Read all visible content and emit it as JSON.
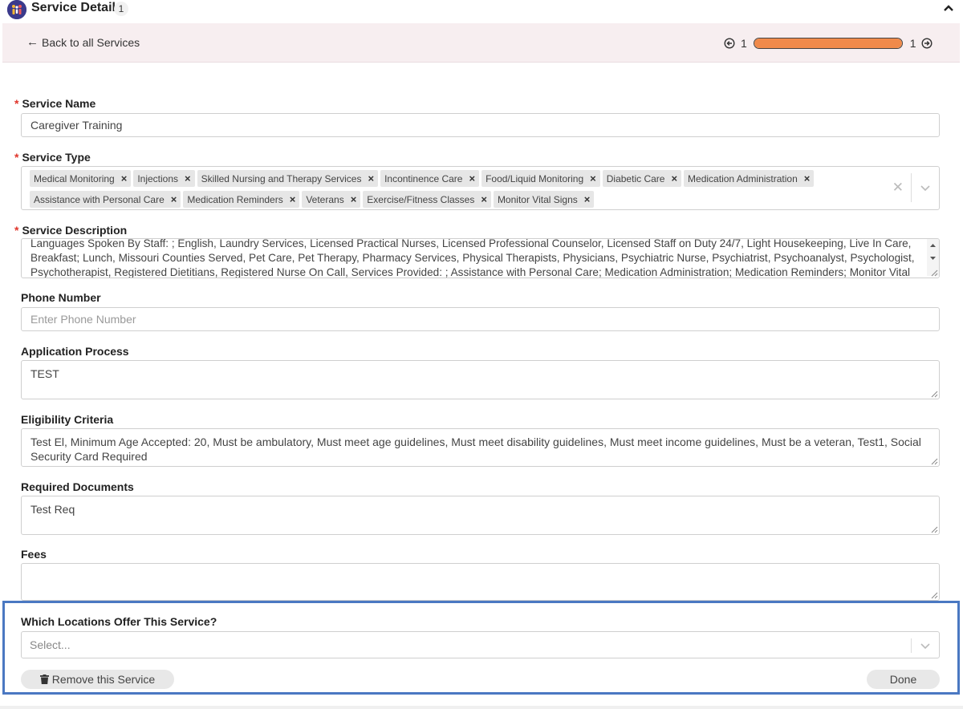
{
  "header": {
    "title": "Service Details",
    "count": "1"
  },
  "nav": {
    "back_label": "Back to all Services",
    "pager_current": "1",
    "pager_total": "1",
    "progress_fraction": 1.0,
    "progress_color": "#f08a4b"
  },
  "form": {
    "service_name": {
      "label": "Service Name",
      "required": true,
      "value": "Caregiver Training"
    },
    "service_type": {
      "label": "Service Type",
      "required": true,
      "tags": [
        "Medical Monitoring",
        "Injections",
        "Skilled Nursing and Therapy Services",
        "Incontinence Care",
        "Food/Liquid Monitoring",
        "Diabetic Care",
        "Medication Administration",
        "Assistance with Personal Care",
        "Medication Reminders",
        "Veterans",
        "Exercise/Fitness Classes",
        "Monitor Vital Signs"
      ]
    },
    "service_description": {
      "label": "Service Description",
      "required": true,
      "value": "Languages Spoken By Staff: ; English, Laundry Services, Licensed Practical Nurses, Licensed Professional Counselor, Licensed Staff on Duty 24/7, Light Housekeeping, Live In Care, Breakfast; Lunch, Missouri Counties Served, Pet Care, Pet Therapy, Pharmacy Services, Physical Therapists, Physicians, Psychiatric Nurse, Psychiatrist, Psychoanalyst, Psychologist, Psychotherapist, Registered Dietitians, Registered Nurse On Call, Services Provided: ; Assistance with Personal Care; Medication Administration; Medication Reminders; Monitor Vital Signs, Single Family"
    },
    "phone_number": {
      "label": "Phone Number",
      "placeholder": "Enter Phone Number"
    },
    "application_process": {
      "label": "Application Process",
      "value": "TEST"
    },
    "eligibility_criteria": {
      "label": "Eligibility Criteria",
      "value": "Test El, Minimum Age Accepted: 20, Must be ambulatory, Must meet age guidelines, Must meet disability guidelines, Must meet income guidelines, Must be a veteran, Test1, Social Security Card Required"
    },
    "required_documents": {
      "label": "Required Documents",
      "value": "Test Req"
    },
    "fees": {
      "label": "Fees",
      "value": ""
    },
    "locations": {
      "label": "Which Locations Offer This Service?",
      "placeholder": "Select..."
    }
  },
  "actions": {
    "remove_label": "Remove this Service",
    "done_label": "Done"
  },
  "colors": {
    "highlight_frame": "#4a78c2",
    "required_star": "#e0352b",
    "nav_background": "#f7eef0"
  }
}
